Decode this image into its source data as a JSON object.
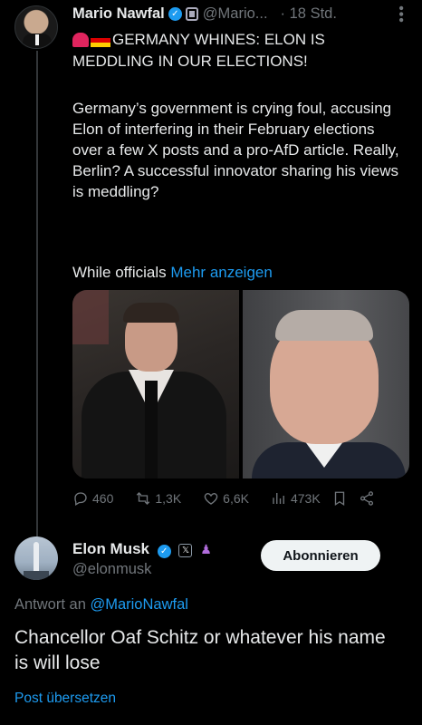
{
  "post": {
    "author_name": "Mario Nawfal",
    "author_handle": "@Mario...",
    "time": "· 18 Std.",
    "headline": "GERMANY WHINES: ELON IS MEDDLING IN OUR ELECTIONS!",
    "paragraph": "Germany’s government is crying foul, accusing Elon of interfering in their February elections over a few X posts and a pro-AfD article. Really, Berlin? A successful innovator sharing his views is meddling?",
    "truncated_text": "While officials",
    "show_more": "Mehr anzeigen",
    "stats": {
      "replies": "460",
      "reposts": "1,3K",
      "likes": "6,6K",
      "views": "473K"
    }
  },
  "reply": {
    "author_name": "Elon Musk",
    "author_handle": "@elonmusk",
    "follow_label": "Abonnieren",
    "reply_prefix": "Antwort an",
    "reply_mention": "@MarioNawfal",
    "text": "Chancellor Oaf Schitz or whatever his name is will lose",
    "translate": "Post übersetzen"
  },
  "icons": {
    "badges": [
      "verified-icon",
      "affiliate-badge-icon",
      "x-badge-icon",
      "people-badge-icon"
    ],
    "flags": [
      "siren-icon",
      "germany-flag-icon"
    ],
    "actions": [
      "reply-icon",
      "repost-icon",
      "like-icon",
      "views-icon",
      "bookmark-icon",
      "share-icon"
    ]
  },
  "colors": {
    "background": "#000000",
    "text": "#e7e9ea",
    "muted": "#71767b",
    "accent": "#1d9bf0"
  }
}
